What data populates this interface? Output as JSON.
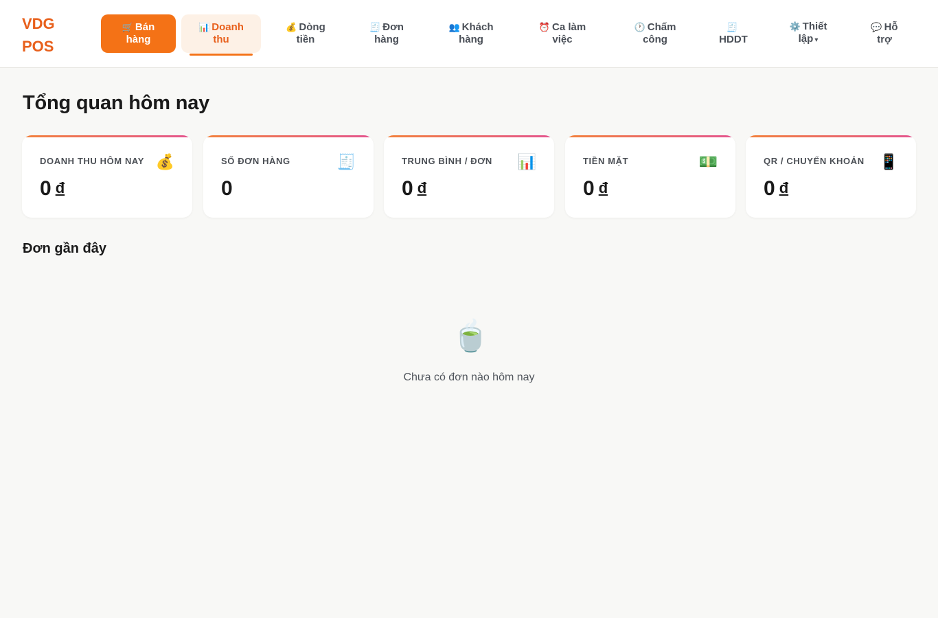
{
  "app": {
    "logo_line1": "VDG",
    "logo_line2": "POS"
  },
  "nav": [
    {
      "icon": "🛒",
      "line1": "Bán",
      "line2": "hàng",
      "state": "primary"
    },
    {
      "icon": "📊",
      "line1": "Doanh",
      "line2": "thu",
      "state": "active"
    },
    {
      "icon": "💰",
      "line1": "Dòng",
      "line2": "tiền",
      "state": "normal"
    },
    {
      "icon": "🧾",
      "line1": "Đơn",
      "line2": "hàng",
      "state": "normal"
    },
    {
      "icon": "👥",
      "line1": "Khách",
      "line2": "hàng",
      "state": "normal"
    },
    {
      "icon": "⏰",
      "line1": "Ca làm",
      "line2": "việc",
      "state": "normal"
    },
    {
      "icon": "🕐",
      "line1": "Chấm",
      "line2": "công",
      "state": "normal"
    },
    {
      "icon": "🧾",
      "line1": "",
      "line2": "HDDT",
      "state": "normal"
    },
    {
      "icon": "⚙️",
      "line1": "Thiết",
      "line2": "lập",
      "state": "normal",
      "caret": "▾"
    },
    {
      "icon": "💬",
      "line1": "Hỗ",
      "line2": "trợ",
      "state": "normal"
    }
  ],
  "main": {
    "title": "Tổng quan hôm nay",
    "stats": [
      {
        "label": "DOANH THU HÔM NAY",
        "icon": "💰",
        "value": "0",
        "currency": "đ"
      },
      {
        "label": "SỐ ĐƠN HÀNG",
        "icon": "🧾",
        "value": "0",
        "currency": ""
      },
      {
        "label": "TRUNG BÌNH / ĐƠN",
        "icon": "📊",
        "value": "0",
        "currency": "đ"
      },
      {
        "label": "TIỀN MẶT",
        "icon": "💵",
        "value": "0",
        "currency": "đ"
      },
      {
        "label": "QR / CHUYỂN KHOẢN",
        "icon": "📱",
        "value": "0",
        "currency": "đ"
      }
    ],
    "recent_title": "Đơn gần đây",
    "empty_icon": "🍵",
    "empty_text": "Chưa có đơn nào hôm nay"
  },
  "colors": {
    "accent": "#f47216",
    "brand": "#e8601c",
    "background": "#f8f8f6"
  }
}
